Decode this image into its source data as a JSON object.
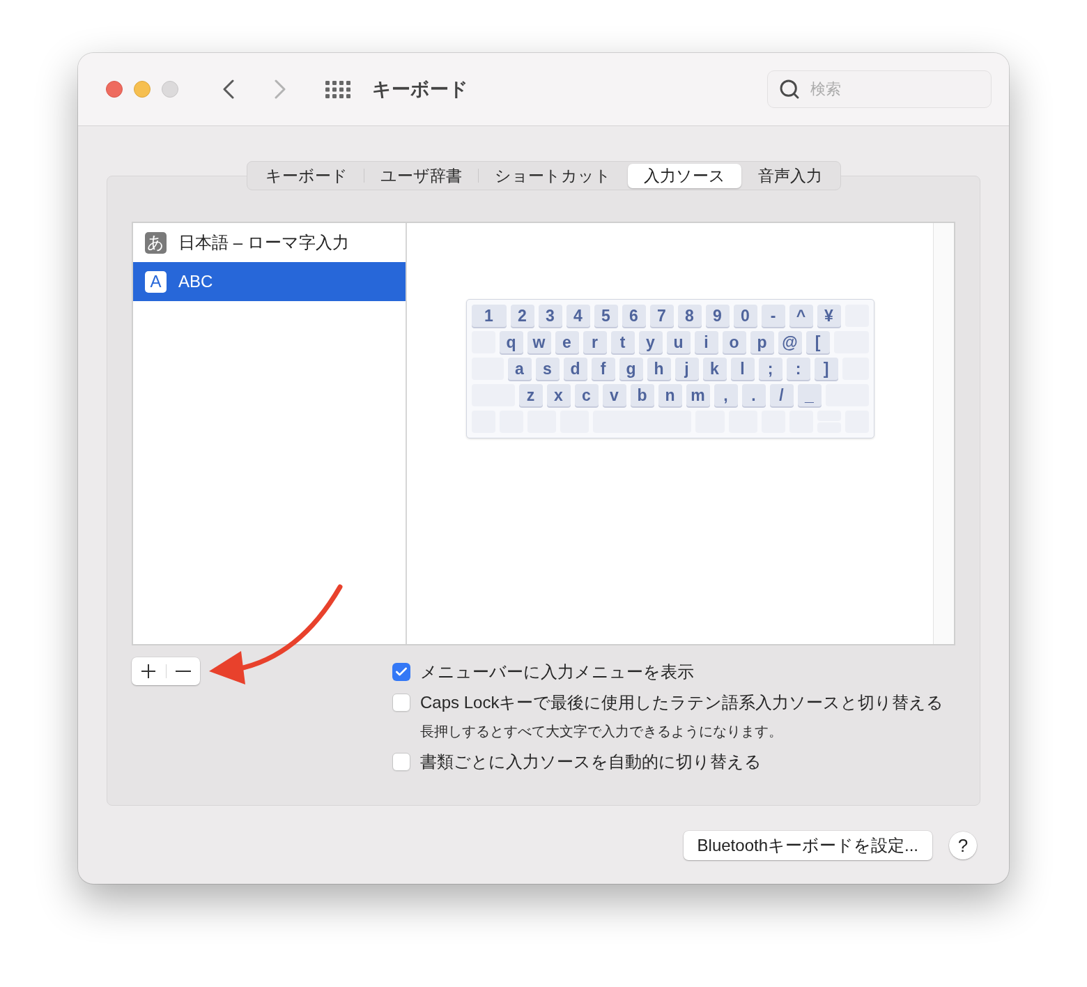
{
  "window": {
    "title": "キーボード",
    "zoom_disabled": true
  },
  "navigation": {
    "back_disabled": false,
    "forward_disabled": true
  },
  "search": {
    "placeholder": "検索"
  },
  "tabs": [
    {
      "label": "キーボード",
      "selected": false
    },
    {
      "label": "ユーザ辞書",
      "selected": false
    },
    {
      "label": "ショートカット",
      "selected": false
    },
    {
      "label": "入力ソース",
      "selected": true
    },
    {
      "label": "音声入力",
      "selected": false
    }
  ],
  "input_sources": [
    {
      "icon_text": "あ",
      "name": "日本語 – ローマ字入力",
      "selected": false
    },
    {
      "icon_text": "A",
      "name": "ABC",
      "selected": true
    }
  ],
  "keyboard_rows": [
    [
      "1",
      "2",
      "3",
      "4",
      "5",
      "6",
      "7",
      "8",
      "9",
      "0",
      "-",
      "^",
      "¥"
    ],
    [
      "q",
      "w",
      "e",
      "r",
      "t",
      "y",
      "u",
      "i",
      "o",
      "p",
      "@",
      "["
    ],
    [
      "a",
      "s",
      "d",
      "f",
      "g",
      "h",
      "j",
      "k",
      "l",
      ";",
      ":",
      "]"
    ],
    [
      "z",
      "x",
      "c",
      "v",
      "b",
      "n",
      "m",
      ",",
      ".",
      "/",
      "_"
    ]
  ],
  "options": [
    {
      "label": "メニューバーに入力メニューを表示",
      "checked": true
    },
    {
      "label": "Caps Lockキーで最後に使用したラテン語系入力ソースと切り替える",
      "checked": false,
      "hint": "長押しするとすべて大文字で入力できるようになります。"
    },
    {
      "label": "書類ごとに入力ソースを自動的に切り替える",
      "checked": false
    }
  ],
  "buttons": {
    "bluetooth": "Bluetoothキーボードを設定...",
    "help": "?"
  }
}
